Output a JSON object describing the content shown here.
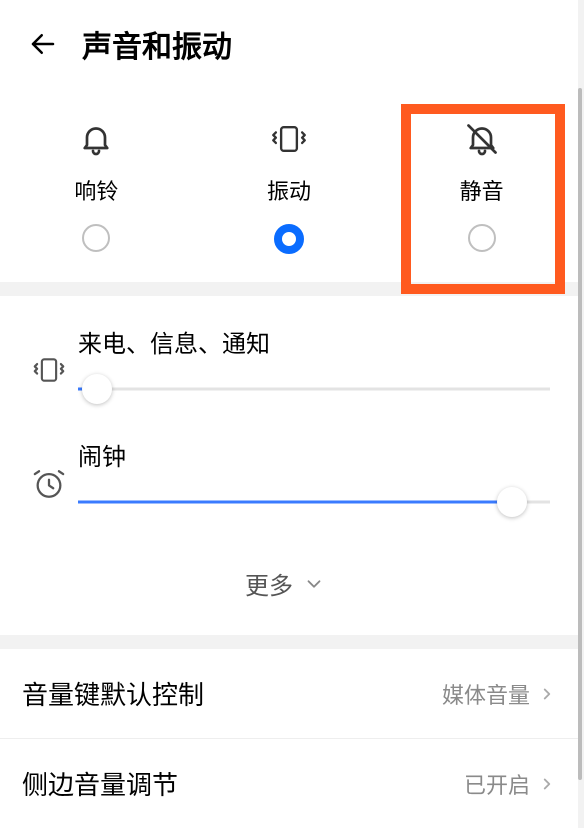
{
  "header": {
    "title": "声音和振动"
  },
  "modes": [
    {
      "key": "ring",
      "label": "响铃",
      "icon": "bell-icon",
      "selected": false
    },
    {
      "key": "vibrate",
      "label": "振动",
      "icon": "vibrate-icon",
      "selected": true
    },
    {
      "key": "silent",
      "label": "静音",
      "icon": "bell-off-icon",
      "selected": false
    }
  ],
  "sliders": {
    "notify": {
      "label": "来电、信息、通知",
      "value_pct": 4
    },
    "alarm": {
      "label": "闹钟",
      "value_pct": 92
    }
  },
  "more_label": "更多",
  "settings": {
    "volume_key": {
      "label": "音量键默认控制",
      "value": "媒体音量"
    },
    "side_volume": {
      "label": "侧边音量调节",
      "value": "已开启"
    }
  }
}
